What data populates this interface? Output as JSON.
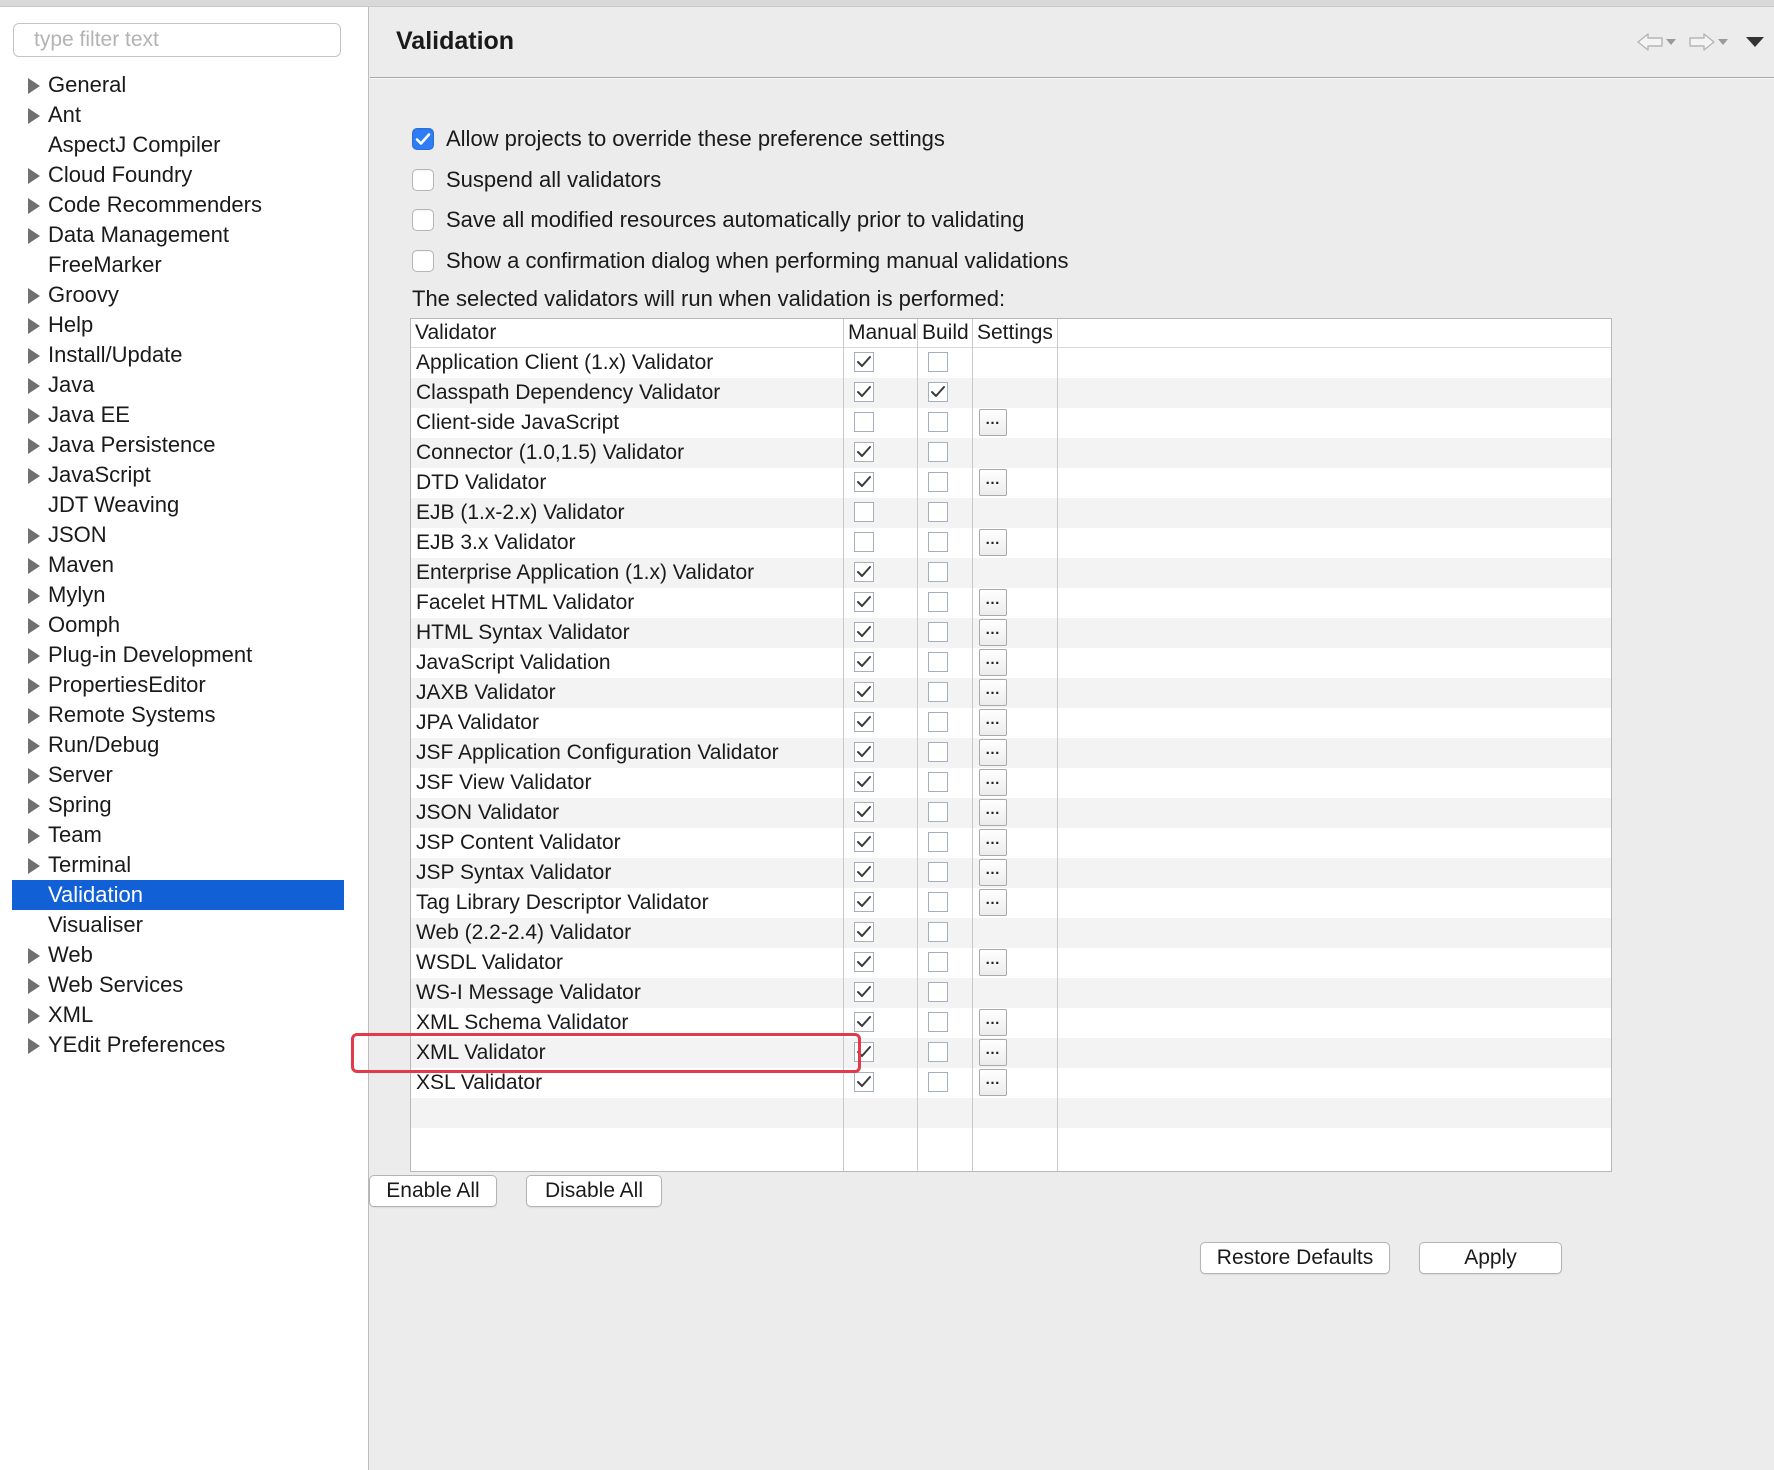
{
  "filter": {
    "placeholder": "type filter text"
  },
  "tree": [
    {
      "label": "General",
      "expandable": true
    },
    {
      "label": "Ant",
      "expandable": true
    },
    {
      "label": "AspectJ Compiler",
      "expandable": false
    },
    {
      "label": "Cloud Foundry",
      "expandable": true
    },
    {
      "label": "Code Recommenders",
      "expandable": true
    },
    {
      "label": "Data Management",
      "expandable": true
    },
    {
      "label": "FreeMarker",
      "expandable": false
    },
    {
      "label": "Groovy",
      "expandable": true
    },
    {
      "label": "Help",
      "expandable": true
    },
    {
      "label": "Install/Update",
      "expandable": true
    },
    {
      "label": "Java",
      "expandable": true
    },
    {
      "label": "Java EE",
      "expandable": true
    },
    {
      "label": "Java Persistence",
      "expandable": true
    },
    {
      "label": "JavaScript",
      "expandable": true
    },
    {
      "label": "JDT Weaving",
      "expandable": false
    },
    {
      "label": "JSON",
      "expandable": true
    },
    {
      "label": "Maven",
      "expandable": true
    },
    {
      "label": "Mylyn",
      "expandable": true
    },
    {
      "label": "Oomph",
      "expandable": true
    },
    {
      "label": "Plug-in Development",
      "expandable": true
    },
    {
      "label": "PropertiesEditor",
      "expandable": true
    },
    {
      "label": "Remote Systems",
      "expandable": true
    },
    {
      "label": "Run/Debug",
      "expandable": true
    },
    {
      "label": "Server",
      "expandable": true
    },
    {
      "label": "Spring",
      "expandable": true
    },
    {
      "label": "Team",
      "expandable": true
    },
    {
      "label": "Terminal",
      "expandable": true
    },
    {
      "label": "Validation",
      "expandable": false,
      "selected": true
    },
    {
      "label": "Visualiser",
      "expandable": false
    },
    {
      "label": "Web",
      "expandable": true
    },
    {
      "label": "Web Services",
      "expandable": true
    },
    {
      "label": "XML",
      "expandable": true
    },
    {
      "label": "YEdit Preferences",
      "expandable": true
    }
  ],
  "page": {
    "title": "Validation",
    "options": [
      {
        "label": "Allow projects to override these preference settings",
        "checked": true
      },
      {
        "label": "Suspend all validators",
        "checked": false
      },
      {
        "label": "Save all modified resources automatically prior to validating",
        "checked": false
      },
      {
        "label": "Show a confirmation dialog when performing manual validations",
        "checked": false
      }
    ],
    "intro": "The selected validators will run when validation is performed:"
  },
  "table": {
    "columns": {
      "validator": "Validator",
      "manual": "Manual",
      "build": "Build",
      "settings": "Settings"
    },
    "rows": [
      {
        "name": "Application Client (1.x) Validator",
        "manual": true,
        "build": false,
        "settings": false
      },
      {
        "name": "Classpath Dependency Validator",
        "manual": true,
        "build": true,
        "settings": false
      },
      {
        "name": "Client-side JavaScript",
        "manual": false,
        "build": false,
        "settings": true
      },
      {
        "name": "Connector (1.0,1.5) Validator",
        "manual": true,
        "build": false,
        "settings": false
      },
      {
        "name": "DTD Validator",
        "manual": true,
        "build": false,
        "settings": true
      },
      {
        "name": "EJB (1.x-2.x) Validator",
        "manual": false,
        "build": false,
        "settings": false
      },
      {
        "name": "EJB 3.x Validator",
        "manual": false,
        "build": false,
        "settings": true
      },
      {
        "name": "Enterprise Application (1.x) Validator",
        "manual": true,
        "build": false,
        "settings": false
      },
      {
        "name": "Facelet HTML Validator",
        "manual": true,
        "build": false,
        "settings": true
      },
      {
        "name": "HTML Syntax Validator",
        "manual": true,
        "build": false,
        "settings": true
      },
      {
        "name": "JavaScript Validation",
        "manual": true,
        "build": false,
        "settings": true
      },
      {
        "name": "JAXB Validator",
        "manual": true,
        "build": false,
        "settings": true
      },
      {
        "name": "JPA Validator",
        "manual": true,
        "build": false,
        "settings": true
      },
      {
        "name": "JSF Application Configuration Validator",
        "manual": true,
        "build": false,
        "settings": true
      },
      {
        "name": "JSF View Validator",
        "manual": true,
        "build": false,
        "settings": true
      },
      {
        "name": "JSON Validator",
        "manual": true,
        "build": false,
        "settings": true
      },
      {
        "name": "JSP Content Validator",
        "manual": true,
        "build": false,
        "settings": true
      },
      {
        "name": "JSP Syntax Validator",
        "manual": true,
        "build": false,
        "settings": true
      },
      {
        "name": "Tag Library Descriptor Validator",
        "manual": true,
        "build": false,
        "settings": true
      },
      {
        "name": "Web (2.2-2.4) Validator",
        "manual": true,
        "build": false,
        "settings": false
      },
      {
        "name": "WSDL Validator",
        "manual": true,
        "build": false,
        "settings": true
      },
      {
        "name": "WS-I Message Validator",
        "manual": true,
        "build": false,
        "settings": false
      },
      {
        "name": "XML Schema Validator",
        "manual": true,
        "build": false,
        "settings": true
      },
      {
        "name": "XML Validator",
        "manual": true,
        "build": false,
        "settings": true,
        "highlighted": true
      },
      {
        "name": "XSL Validator",
        "manual": true,
        "build": false,
        "settings": true
      }
    ],
    "settings_button_label": "…"
  },
  "buttons": {
    "enable_all": "Enable All",
    "disable_all": "Disable All",
    "restore_defaults": "Restore Defaults",
    "apply": "Apply"
  },
  "colors": {
    "selection": "#1160d6",
    "highlight_box": "#e23a4a",
    "checkbox_on": "#2e7cf6"
  }
}
